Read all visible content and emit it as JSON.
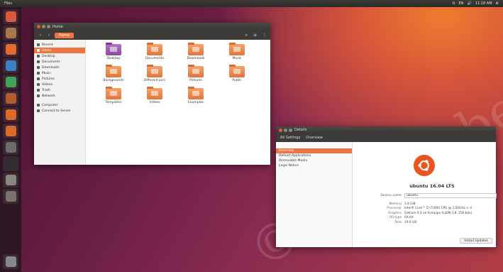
{
  "topbar": {
    "app": "Files",
    "tray": [
      "⇅",
      "EN",
      "🔊",
      "11:18 AM",
      "⚙"
    ]
  },
  "launcher": {
    "apps": [
      {
        "name": "ubuntu-dash-icon",
        "color": "#d95a3a"
      },
      {
        "name": "files-icon",
        "color": "#a9784a"
      },
      {
        "name": "firefox-icon",
        "color": "#e66a2e"
      },
      {
        "name": "writer-icon",
        "color": "#3d7fc4"
      },
      {
        "name": "calc-icon",
        "color": "#3ea458"
      },
      {
        "name": "impress-icon",
        "color": "#b45a2c"
      },
      {
        "name": "software-center-icon",
        "color": "#dd6a24"
      },
      {
        "name": "amazon-icon",
        "color": "#d86a2a"
      },
      {
        "name": "settings-icon",
        "color": "#6f6b66"
      },
      {
        "name": "terminal-icon",
        "color": "#2e2e2e"
      },
      {
        "name": "disk-icon",
        "color": "#8a8781"
      },
      {
        "name": "workspaces-icon",
        "color": "#777470"
      }
    ],
    "trash_color": "#888"
  },
  "files": {
    "window_title": "Home",
    "location": "Home",
    "sidebar": [
      {
        "label": "Recent",
        "active": false
      },
      {
        "label": "Home",
        "active": true
      },
      {
        "label": "Desktop",
        "active": false
      },
      {
        "label": "Documents",
        "active": false
      },
      {
        "label": "Downloads",
        "active": false
      },
      {
        "label": "Music",
        "active": false
      },
      {
        "label": "Pictures",
        "active": false
      },
      {
        "label": "Videos",
        "active": false
      },
      {
        "label": "Trash",
        "active": false
      },
      {
        "label": "Network",
        "active": false
      },
      {
        "label": "Computer",
        "active": false
      },
      {
        "label": "Connect to Server",
        "active": false
      }
    ],
    "folders": [
      {
        "label": "Desktop",
        "purple": true
      },
      {
        "label": "Documents",
        "purple": false
      },
      {
        "label": "Downloads",
        "purple": false
      },
      {
        "label": "Music",
        "purple": false
      },
      {
        "label": "Backgrounds",
        "purple": false
      },
      {
        "label": "Different pics",
        "purple": false
      },
      {
        "label": "Pictures",
        "purple": false
      },
      {
        "label": "Public",
        "purple": false
      },
      {
        "label": "Templates",
        "purple": false
      },
      {
        "label": "Videos",
        "purple": false
      },
      {
        "label": "Examples",
        "purple": false
      }
    ]
  },
  "details": {
    "window_title": "Details",
    "subtitle": "Overview",
    "back_label": "All Settings",
    "nav": [
      {
        "label": "Overview",
        "active": true
      },
      {
        "label": "Default Applications",
        "active": false
      },
      {
        "label": "Removable Media",
        "active": false
      },
      {
        "label": "Legal Notice",
        "active": false
      }
    ],
    "os_name": "ubuntu 16.04 LTS",
    "device_name_label": "Device name",
    "device_name": "ubuntu",
    "specs": [
      {
        "k": "Memory",
        "v": "3.8 GiB"
      },
      {
        "k": "Processor",
        "v": "Intel® Core™ i5-7200U CPU @ 2.50GHz × 4"
      },
      {
        "k": "Graphics",
        "v": "Gallium 0.4 on llvmpipe (LLVM 3.8, 256 bits)"
      },
      {
        "k": "OS type",
        "v": "64-bit"
      },
      {
        "k": "Disk",
        "v": "19.6 GB"
      }
    ],
    "update_label": "Install Updates"
  },
  "watermark": "© Not to be republished",
  "colors": {
    "accent": "#ed7541",
    "ubuntu_orange": "#e95420"
  }
}
